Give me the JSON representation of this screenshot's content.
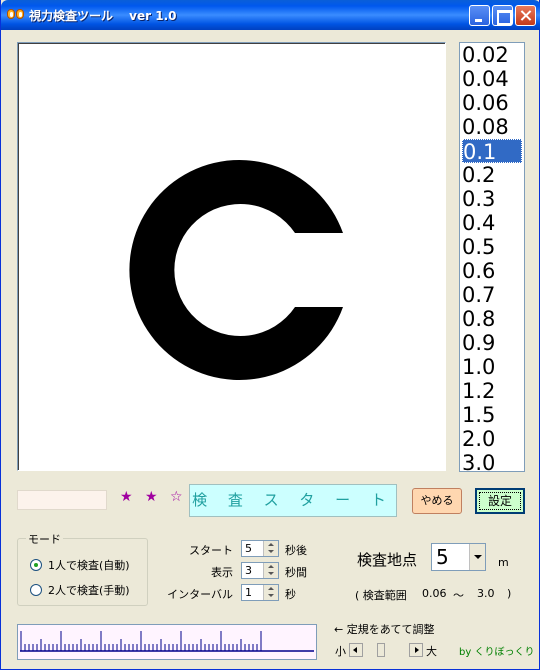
{
  "window": {
    "title": "視力検査ツール　 ver 1.0",
    "controls": [
      "minimize-icon",
      "maximize-icon",
      "close-icon"
    ]
  },
  "display": {
    "symbol": "landolt-ring-icon",
    "gap_direction": "right"
  },
  "acuity_list": {
    "items": [
      "0.02",
      "0.04",
      "0.06",
      "0.08",
      "0.1",
      "0.2",
      "0.3",
      "0.4",
      "0.5",
      "0.6",
      "0.7",
      "0.8",
      "0.9",
      "1.0",
      "1.2",
      "1.5",
      "2.0",
      "3.0"
    ],
    "selected": "0.1"
  },
  "status": {
    "field_value": "",
    "stars": "★ ★ ☆"
  },
  "buttons": {
    "start": "検 査 ス タ ー ト",
    "stop": "やめる",
    "settings": "設定"
  },
  "mode": {
    "legend": "モード",
    "options": [
      {
        "label": "1人で検査(自動)",
        "selected": true
      },
      {
        "label": "2人で検査(手動)",
        "selected": false
      }
    ]
  },
  "timing": {
    "start_label": "スタート",
    "start_value": "5",
    "start_unit": "秒後",
    "display_label": "表示",
    "display_value": "3",
    "display_unit": "秒間",
    "interval_label": "インターバル",
    "interval_value": "1",
    "interval_unit": "秒"
  },
  "distance": {
    "label": "検査地点",
    "value": "5",
    "unit": "m",
    "range_open": "( 検査範囲",
    "range_min": "0.06",
    "range_sep": "～",
    "range_max": "3.0",
    "range_close": ")"
  },
  "ruler": {
    "hint": "← 定規をあてて調整",
    "small_label": "小",
    "large_label": "大"
  },
  "credit": "by くりぼっくり",
  "colors": {
    "title_bar": "#0054e3",
    "selection": "#316ac5",
    "start_button": "#ccffff",
    "stop_button": "#ffd7b0",
    "settings_button": "#ccffcc",
    "stars": "#a000a0",
    "ruler_line": "#00008b",
    "credit": "#008000"
  }
}
